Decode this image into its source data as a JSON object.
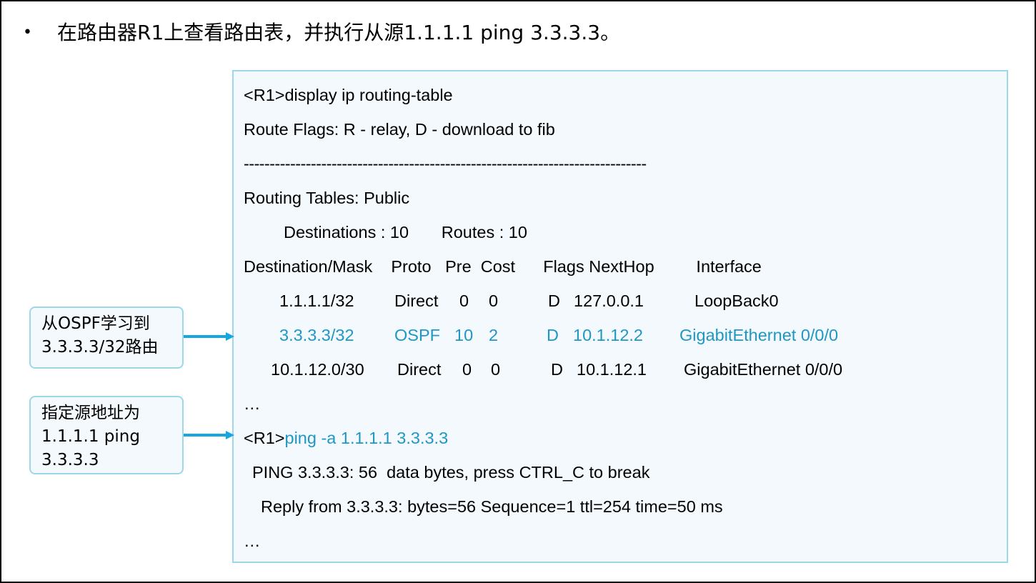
{
  "heading": {
    "bullet": "•",
    "text": "在路由器R1上查看路由表，并执行从源1.1.1.1 ping 3.3.3.3。"
  },
  "terminal": {
    "cmd1": "<R1>display ip routing-table",
    "flags": "Route Flags: R - relay, D - download to fib",
    "separator": "------------------------------------------------------------------------------",
    "tables": "Routing Tables: Public",
    "summary": "Destinations : 10       Routes : 10",
    "header": "Destination/Mask    Proto   Pre  Cost      Flags NextHop         Interface",
    "routes": [
      {
        "dest": "1.1.1.1/32",
        "proto": "Direct",
        "pre": "0",
        "cost": "0",
        "flags": "D",
        "nexthop": "127.0.0.1",
        "iface": "LoopBack0"
      },
      {
        "dest": "3.3.3.3/32",
        "proto": "OSPF",
        "pre": "10",
        "cost": "2",
        "flags": "D",
        "nexthop": "10.1.12.2",
        "iface": "GigabitEthernet 0/0/0"
      },
      {
        "dest": "10.1.12.0/30",
        "proto": "Direct",
        "pre": "0",
        "cost": "0",
        "flags": "D",
        "nexthop": "10.1.12.1",
        "iface": "GigabitEthernet 0/0/0"
      }
    ],
    "ellipsis1": "…",
    "prompt2": "<R1>",
    "cmd2": "ping -a 1.1.1.1 3.3.3.3",
    "ping_line": "PING 3.3.3.3: 56  data bytes, press CTRL_C to break",
    "reply_line": "Reply from 3.3.3.3: bytes=56 Sequence=1 ttl=254 time=50 ms",
    "ellipsis2": "…"
  },
  "callouts": {
    "ospf": {
      "line1": "从OSPF学习到",
      "line2": "3.3.3.3/32路由"
    },
    "source": {
      "line1": "指定源地址为",
      "line2": "1.1.1.1 ping",
      "line3": "3.3.3.3"
    }
  },
  "colors": {
    "highlight": "#1f97c4",
    "arrow": "#16a6e0",
    "panel_border": "#9ed8e8",
    "panel_bg": "#f3f9fc"
  }
}
